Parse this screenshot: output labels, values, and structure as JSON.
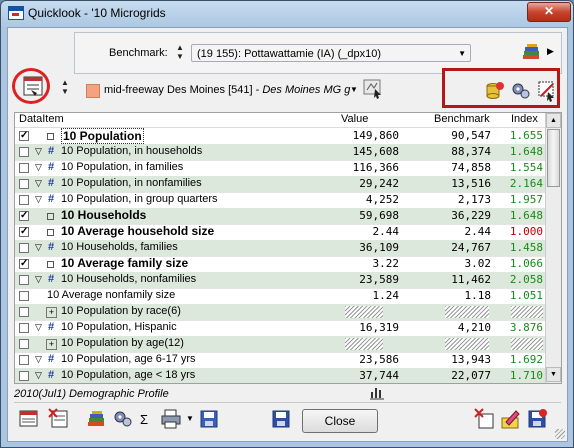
{
  "window": {
    "title": "Quicklook - '10 Microgrids",
    "close_glyph": "✕"
  },
  "benchmark": {
    "label": "Benchmark:",
    "value": "(19 155): Pottawattamie (IA) (_dpx10)"
  },
  "region": {
    "swatch_color": "#f4a37e",
    "text_main": "mid-freeway Des Moines [541] - ",
    "text_italic": "Des Moines MG g"
  },
  "grid": {
    "columns": [
      "DataItem",
      "Value",
      "Benchmark",
      "Index"
    ],
    "index_color": "#1a8a1a",
    "index_red_color": "#c00000",
    "rows": [
      {
        "label": "10 Population",
        "bold": true,
        "checked": true,
        "kind": "top",
        "value": "149,860",
        "bench": "90,547",
        "index": "1.655",
        "shaded": false,
        "selected": true
      },
      {
        "label": "10 Population, in households",
        "kind": "sub",
        "value": "145,608",
        "bench": "88,374",
        "index": "1.648",
        "shaded": true
      },
      {
        "label": "10 Population, in families",
        "kind": "sub",
        "value": "116,366",
        "bench": "74,858",
        "index": "1.554",
        "shaded": false
      },
      {
        "label": "10 Population, in nonfamilies",
        "kind": "sub",
        "value": "29,242",
        "bench": "13,516",
        "index": "2.164",
        "shaded": true
      },
      {
        "label": "10 Population, in group quarters",
        "kind": "sub",
        "value": "4,252",
        "bench": "2,173",
        "index": "1.957",
        "shaded": false
      },
      {
        "label": "10 Households",
        "bold": true,
        "checked": true,
        "kind": "top",
        "value": "59,698",
        "bench": "36,229",
        "index": "1.648",
        "shaded": true
      },
      {
        "label": "10 Average household size",
        "bold": true,
        "checked": true,
        "kind": "top",
        "value": "2.44",
        "bench": "2.44",
        "index": "1.000",
        "shaded": false,
        "red": true
      },
      {
        "label": "10 Households, families",
        "kind": "sub",
        "value": "36,109",
        "bench": "24,767",
        "index": "1.458",
        "shaded": true
      },
      {
        "label": "10 Average family size",
        "bold": true,
        "checked": true,
        "kind": "top",
        "value": "3.22",
        "bench": "3.02",
        "index": "1.066",
        "shaded": false
      },
      {
        "label": "10 Households, nonfamilies",
        "kind": "sub",
        "value": "23,589",
        "bench": "11,462",
        "index": "2.058",
        "shaded": true
      },
      {
        "label": "10 Average nonfamily size",
        "kind": "plain",
        "value": "1.24",
        "bench": "1.18",
        "index": "1.051",
        "shaded": false
      },
      {
        "label": "10 Population by race(6)",
        "kind": "group",
        "value": "",
        "bench": "",
        "index": "",
        "shaded": true,
        "hatched": true
      },
      {
        "label": "10 Population, Hispanic",
        "kind": "sub",
        "value": "16,319",
        "bench": "4,210",
        "index": "3.876",
        "shaded": false
      },
      {
        "label": "10 Population by age(12)",
        "kind": "group",
        "value": "",
        "bench": "",
        "index": "",
        "shaded": true,
        "hatched": true
      },
      {
        "label": "10 Population, age 6-17 yrs",
        "kind": "sub",
        "value": "23,586",
        "bench": "13,943",
        "index": "1.692",
        "shaded": false
      },
      {
        "label": "10 Population, age < 18 yrs",
        "kind": "sub",
        "value": "37,744",
        "bench": "22,077",
        "index": "1.710",
        "shaded": true
      }
    ]
  },
  "footer": {
    "profile_label": "2010(Jul1) Demographic Profile",
    "close_label": "Close",
    "sigma": "Σ"
  }
}
